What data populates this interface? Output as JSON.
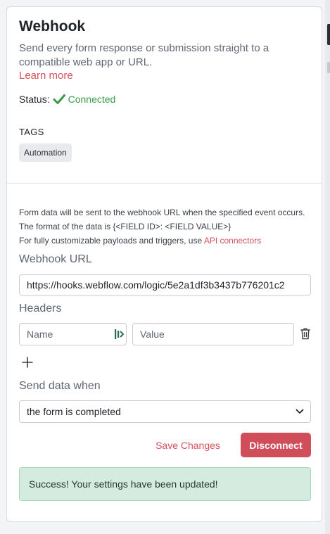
{
  "webhook": {
    "title": "Webhook",
    "description": "Send every form response or submission straight to a compatible web app or URL.",
    "learn_more": "Learn more",
    "status_label": "Status:",
    "status_value": "Connected",
    "tags_label": "TAGS",
    "tags": [
      "Automation"
    ]
  },
  "config": {
    "info_line1": "Form data will be sent to the webhook URL when the specified event occurs. The format of the data is {<FIELD ID>: <FIELD VALUE>}",
    "info_line2": "For fully customizable payloads and triggers, use ",
    "api_link": "API connectors",
    "url_label": "Webhook URL",
    "url_value": "https://hooks.webflow.com/logic/5e2a1df3b3437b776201c2",
    "headers_label": "Headers",
    "header_name_placeholder": "Name",
    "header_value_placeholder": "Value",
    "send_label": "Send data when",
    "send_selected": "the form is completed",
    "save_label": "Save Changes",
    "disconnect_label": "Disconnect",
    "success_message": "Success! Your settings have been updated!"
  },
  "colors": {
    "accent": "#d04d5a",
    "link": "#d4515b",
    "connected": "#3a9a4a",
    "success_bg": "#d4ebdf"
  },
  "icons": [
    "check-icon",
    "field-picker-icon",
    "trash-icon",
    "plus-icon",
    "chevron-down-icon"
  ]
}
